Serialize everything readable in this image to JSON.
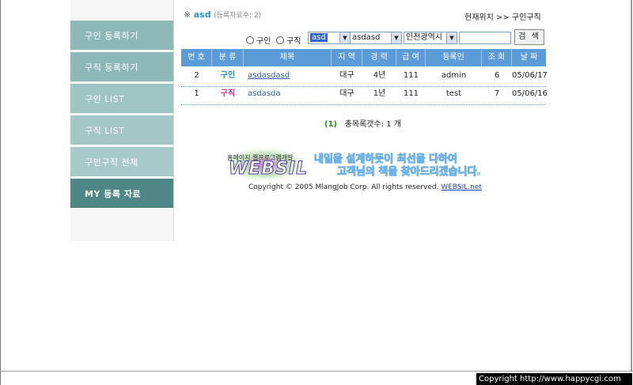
{
  "sidebar": {
    "items": [
      {
        "label": "구인 등록하기",
        "color": "#8db8b8"
      },
      {
        "label": "구직 등록하기",
        "color": "#8db8b8"
      },
      {
        "label": "구인 LIST",
        "color": "#9fc4c4"
      },
      {
        "label": "구직 LIST",
        "color": "#a4c6c6"
      },
      {
        "label": "구인구직 전체",
        "color": "#a8c9c9"
      },
      {
        "label": "MY 등록 자료",
        "color": "#4f8686"
      }
    ]
  },
  "header": {
    "mark": "※",
    "category": "asd",
    "count_text": "(등록자료수: 2)",
    "location": "현재위치 >> 구인구직"
  },
  "search": {
    "radio_1": "구인",
    "radio_2": "구직",
    "select_1": "asd",
    "select_2": "asdasd",
    "select_3": "인천광역시",
    "button": "검 색"
  },
  "table": {
    "headers": [
      "번 호",
      "분 류",
      "제목",
      "지 역",
      "경 력",
      "급 여",
      "등록인",
      "조 회",
      "날 짜"
    ],
    "rows": [
      {
        "no": "2",
        "type": "구인",
        "title": "asdasdasd",
        "region": "대구",
        "career": "4년",
        "pay": "111",
        "user": "admin",
        "views": "6",
        "date": "05/06/17"
      },
      {
        "no": "1",
        "type": "구직",
        "title": "asdasda",
        "region": "대구",
        "career": "1년",
        "pay": "111",
        "user": "test",
        "views": "7",
        "date": "05/06/16"
      }
    ]
  },
  "pager": {
    "page": "(1)",
    "total": "총목록갯수: 1 개"
  },
  "logo": {
    "sub": "홈페이지 웹프로그램개발",
    "brand": "WEBSIL",
    "slogan_1": "내일을 설계하듯이 최선을 다하여",
    "slogan_2": "고객님의 책을 찾아드리겠습니다."
  },
  "copyright": {
    "text": "Copyright © 2005 MlangJob Corp. All rights reserved.",
    "link": "WEBSIL.net"
  },
  "footer": {
    "text": "Copyright  http://www.happycgi.com"
  }
}
